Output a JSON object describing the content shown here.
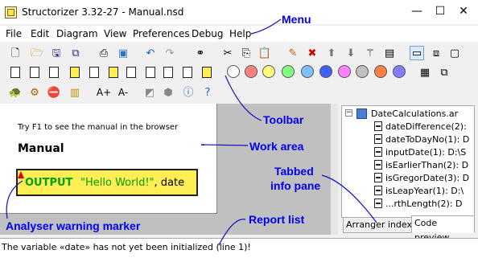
{
  "window": {
    "title": "Structorizer 3.32-27 - Manual.nsd",
    "min_icon": "minimize-icon",
    "max_icon": "maximize-icon",
    "close_icon": "close-icon"
  },
  "menubar": {
    "items": [
      "File",
      "Edit",
      "Diagram",
      "View",
      "Preferences",
      "Debug",
      "Help"
    ]
  },
  "toolbar": {
    "colors": [
      "#ffffff",
      "#ff8080",
      "#ffff80",
      "#80ff80",
      "#80c0ff",
      "#4060ff",
      "#ff80ff",
      "#c0c0c0",
      "#ff8040",
      "#8080ff"
    ],
    "zoom_in_label": "A+",
    "zoom_out_label": "A-"
  },
  "diagram": {
    "hint": "Try F1 to see the manual in the browser",
    "title": "Manual",
    "output_keyword": "OUTPUT",
    "output_string": "\"Hello World!\"",
    "output_rest": ", date"
  },
  "arranger": {
    "root": "DateCalculations.ar",
    "items": [
      "dateDifference(2): ",
      "dateToDayNo(1): D",
      "inputDate(1): D:\\S",
      "isEarlierThan(2): D",
      "isGregorDate(3): D",
      "isLeapYear(1): D:\\",
      "...rthLength(2): D"
    ],
    "tabs": [
      "Arranger index",
      "Code preview"
    ],
    "active_tab": 1
  },
  "status": {
    "report": "The variable «date» has not yet been initialized (line 1)!"
  },
  "callouts": {
    "menu": "Menu",
    "toolbar": "Toolbar",
    "work_area": "Work area",
    "tabbed_info_pane_line1": "Tabbed",
    "tabbed_info_pane_line2": "info pane",
    "analyser": "Analyser warning marker",
    "report_list": "Report list"
  }
}
